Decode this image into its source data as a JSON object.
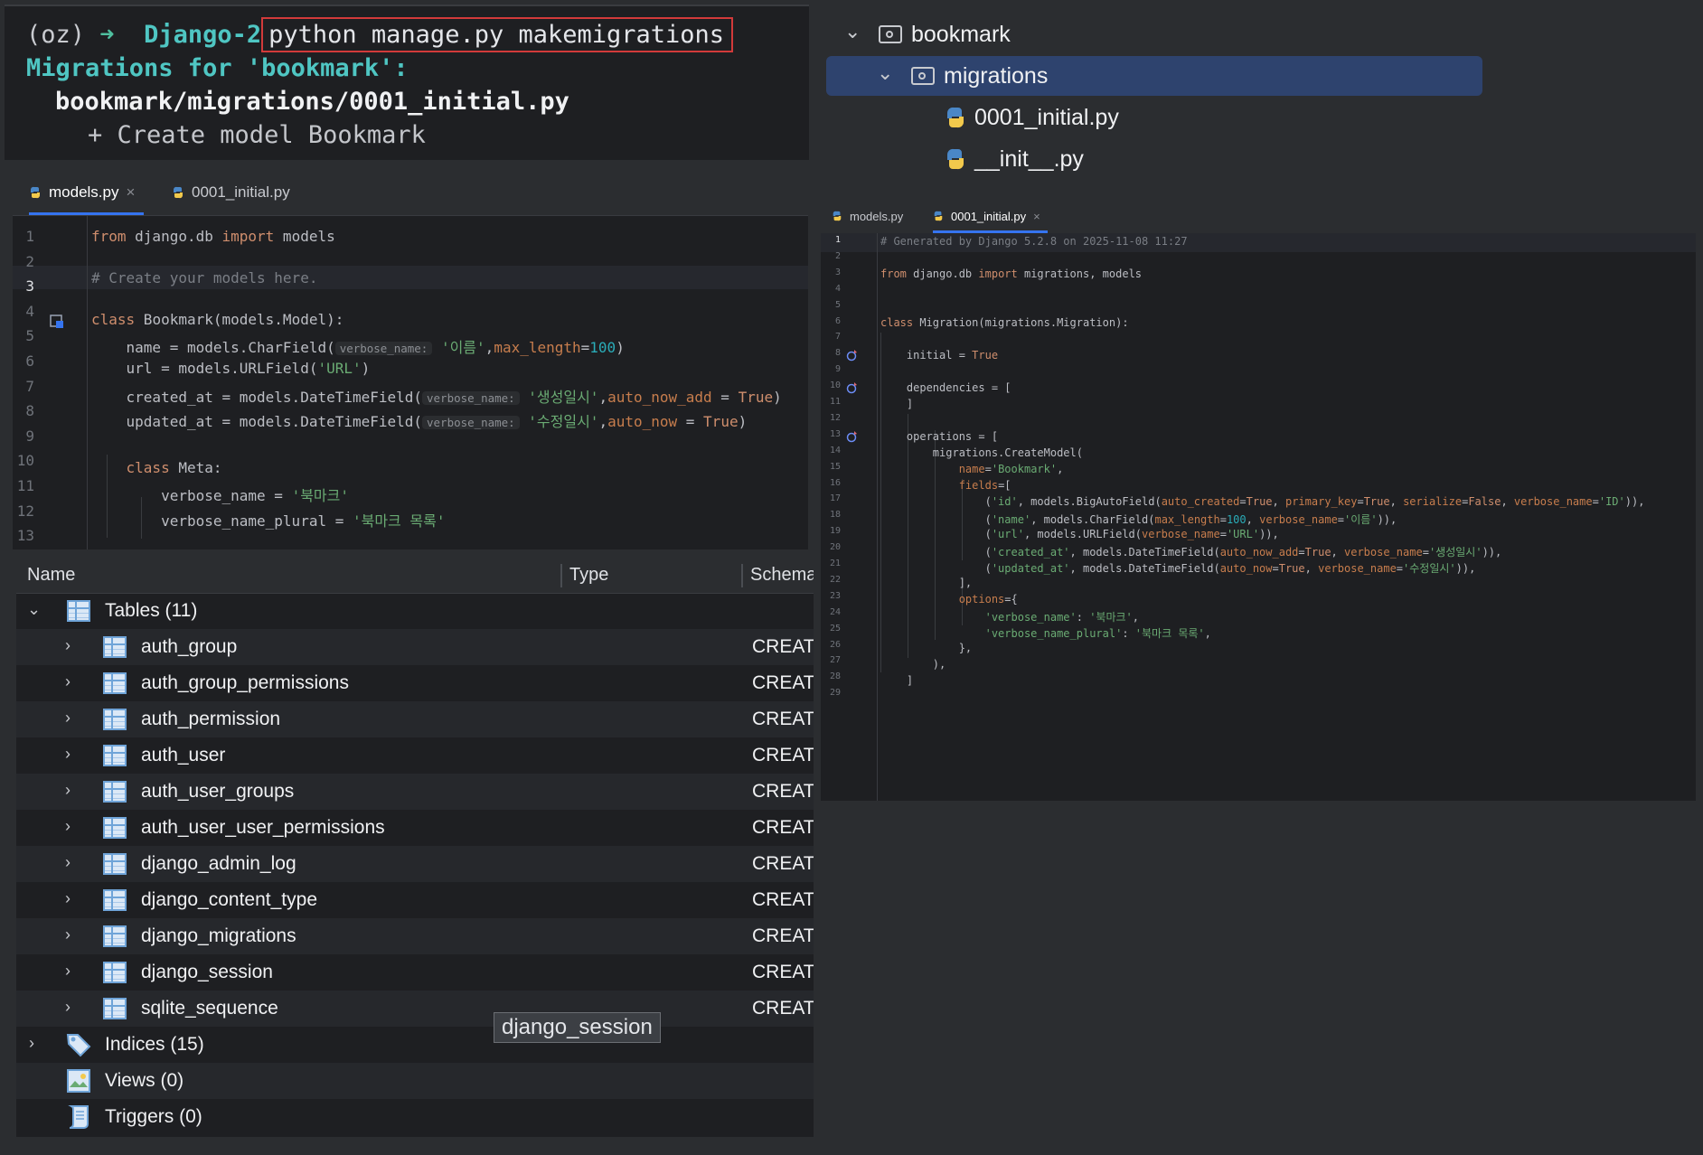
{
  "terminal": {
    "prompt": "(oz)",
    "arrow": "➜",
    "dir": "Django-2",
    "command": "python manage.py makemigrations",
    "migrations_for": "Migrations for 'bookmark':",
    "file": "bookmark/migrations/0001_initial.py",
    "create": "+ Create model Bookmark"
  },
  "left_editor": {
    "tabs": [
      {
        "label": "models.py",
        "active": true,
        "close": "×"
      },
      {
        "label": "0001_initial.py",
        "active": false
      }
    ],
    "line_numbers": [
      "1",
      "2",
      "3",
      "4",
      "5",
      "6",
      "7",
      "8",
      "9",
      "10",
      "11",
      "12",
      "13"
    ],
    "hint_label": "verbose_name:"
  },
  "project_tree": {
    "items": [
      {
        "label": "bookmark",
        "kind": "folder",
        "expanded": true
      },
      {
        "label": "migrations",
        "kind": "folder",
        "expanded": true,
        "selected": true
      },
      {
        "label": "0001_initial.py",
        "kind": "python"
      },
      {
        "label": "__init__.py",
        "kind": "python"
      }
    ]
  },
  "right_editor": {
    "tabs": [
      {
        "label": "models.py",
        "active": false
      },
      {
        "label": "0001_initial.py",
        "active": true,
        "close": "×"
      }
    ],
    "line_numbers": [
      "1",
      "2",
      "3",
      "4",
      "5",
      "6",
      "7",
      "8",
      "9",
      "10",
      "11",
      "12",
      "13",
      "14",
      "15",
      "16",
      "17",
      "18",
      "19",
      "20",
      "21",
      "22",
      "23",
      "24",
      "25",
      "26",
      "27",
      "28",
      "29"
    ]
  },
  "database": {
    "columns": [
      "Name",
      "Type",
      "Schema"
    ],
    "tables_group": "Tables (11)",
    "tables": [
      {
        "name": "auth_group",
        "type": "CREATE"
      },
      {
        "name": "auth_group_permissions",
        "type": "CREATE"
      },
      {
        "name": "auth_permission",
        "type": "CREATE"
      },
      {
        "name": "auth_user",
        "type": "CREATE"
      },
      {
        "name": "auth_user_groups",
        "type": "CREATE"
      },
      {
        "name": "auth_user_user_permissions",
        "type": "CREATE"
      },
      {
        "name": "django_admin_log",
        "type": "CREATE"
      },
      {
        "name": "django_content_type",
        "type": "CREATE"
      },
      {
        "name": "django_migrations",
        "type": "CREATE"
      },
      {
        "name": "django_session",
        "type": "CREATE"
      },
      {
        "name": "sqlite_sequence",
        "type": "CREATE"
      }
    ],
    "indices_group": "Indices (15)",
    "views_group": "Views (0)",
    "triggers_group": "Triggers (0)",
    "tooltip": "django_session"
  },
  "colors": {
    "background": "#2b2d30",
    "editor_bg": "#1e1f22",
    "accent": "#3574f0",
    "keyword": "#cf8e6d",
    "string": "#6aab73",
    "number": "#2aacb8",
    "command_highlight": "#d23a3a"
  }
}
